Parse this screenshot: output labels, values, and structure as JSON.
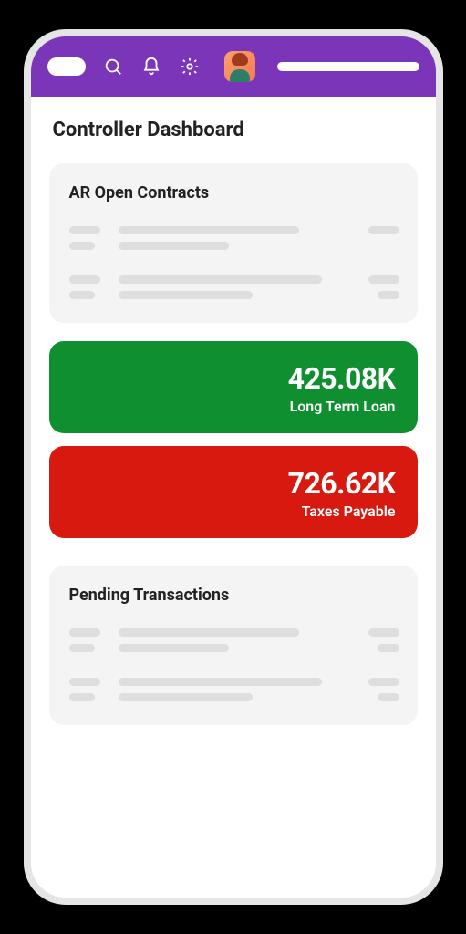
{
  "header": {
    "icons": [
      "search-icon",
      "bell-icon",
      "gear-icon"
    ]
  },
  "page": {
    "title": "Controller Dashboard"
  },
  "cards": {
    "ar_open": {
      "title": "AR Open Contracts"
    },
    "pending": {
      "title": "Pending Transactions"
    }
  },
  "stats": [
    {
      "value": "425.08K",
      "label": "Long Term Loan",
      "color": "#0F8F2F"
    },
    {
      "value": "726.62K",
      "label": "Taxes Payable",
      "color": "#D7190F"
    }
  ]
}
